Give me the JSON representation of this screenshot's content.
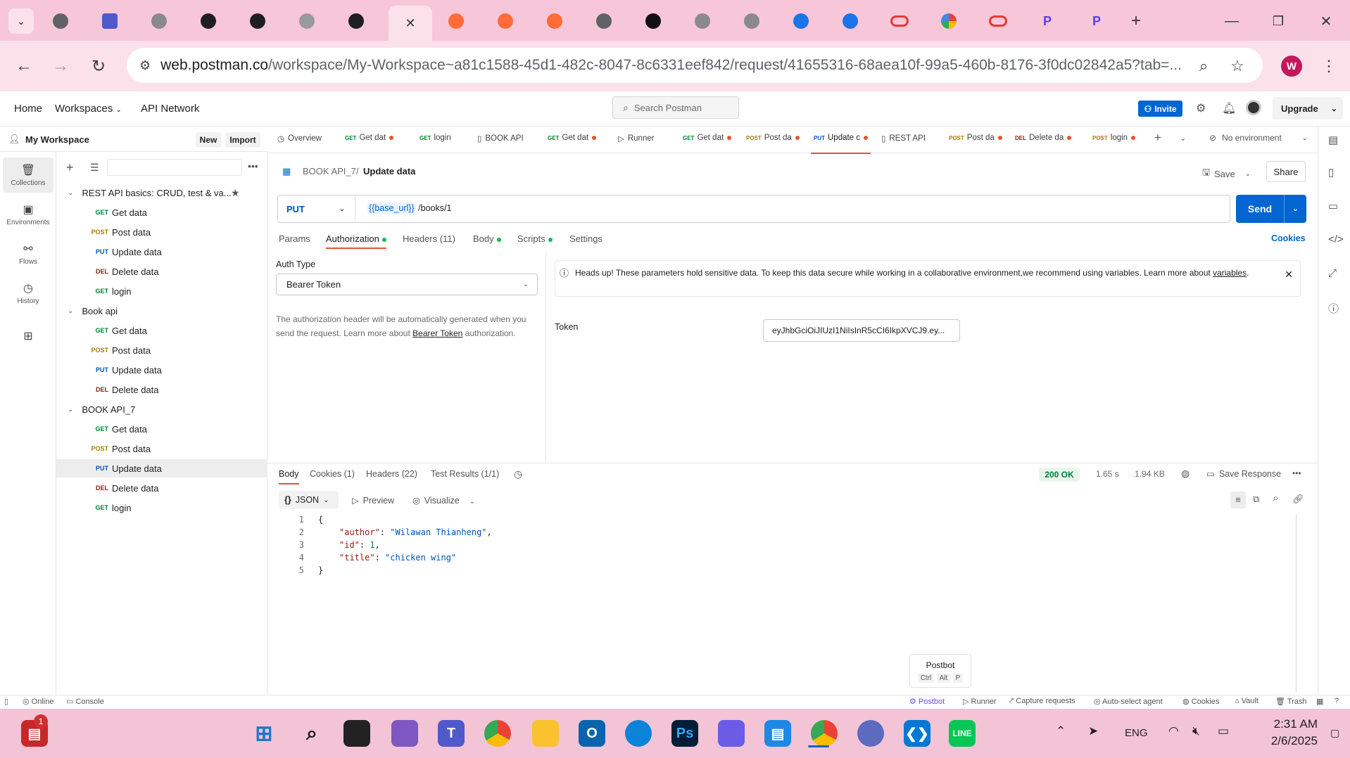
{
  "browser": {
    "url_host": "web.postman.co",
    "url_path": "/workspace/My-Workspace~a81c1588-45d1-482c-8047-8c6331eef842/request/41655316-68aea10f-99a5-460b-8176-3f0dc02842a5?tab=...",
    "profile_initial": "W"
  },
  "header": {
    "nav": [
      "Home",
      "Workspaces",
      "API Network"
    ],
    "search_placeholder": "Search Postman",
    "invite": "Invite",
    "upgrade": "Upgrade"
  },
  "rail": [
    "Collections",
    "Environments",
    "Flows",
    "History"
  ],
  "workspace": {
    "name": "My Workspace",
    "new": "New",
    "import": "Import"
  },
  "collections": [
    {
      "name": "REST API basics: CRUD, test & va...",
      "items": [
        {
          "method": "GET",
          "name": "Get data"
        },
        {
          "method": "POST",
          "name": "Post data"
        },
        {
          "method": "PUT",
          "name": "Update data"
        },
        {
          "method": "DEL",
          "name": "Delete data"
        },
        {
          "method": "GET",
          "name": "login"
        }
      ]
    },
    {
      "name": "Book api",
      "items": [
        {
          "method": "GET",
          "name": "Get data"
        },
        {
          "method": "POST",
          "name": "Post data"
        },
        {
          "method": "PUT",
          "name": "Update data"
        },
        {
          "method": "DEL",
          "name": "Delete data"
        }
      ]
    },
    {
      "name": "BOOK API_7",
      "items": [
        {
          "method": "GET",
          "name": "Get data"
        },
        {
          "method": "POST",
          "name": "Post data"
        },
        {
          "method": "PUT",
          "name": "Update data"
        },
        {
          "method": "DEL",
          "name": "Delete data"
        },
        {
          "method": "GET",
          "name": "login"
        }
      ]
    }
  ],
  "request_tabs": [
    {
      "method": "",
      "label": "Overview"
    },
    {
      "method": "GET",
      "label": "Get dat"
    },
    {
      "method": "GET",
      "label": "login"
    },
    {
      "method": "",
      "label": "BOOK API"
    },
    {
      "method": "GET",
      "label": "Get dat"
    },
    {
      "method": "",
      "label": "Runner"
    },
    {
      "method": "GET",
      "label": "Get dat"
    },
    {
      "method": "POST",
      "label": "Post da"
    },
    {
      "method": "PUT",
      "label": "Update c"
    },
    {
      "method": "",
      "label": "REST API"
    },
    {
      "method": "POST",
      "label": "Post da"
    },
    {
      "method": "DEL",
      "label": "Delete da"
    },
    {
      "method": "POST",
      "label": "login"
    }
  ],
  "environment": "No environment",
  "breadcrumb": {
    "collection": "BOOK API_7",
    "request": "Update data"
  },
  "actions": {
    "save": "Save",
    "share": "Share",
    "send": "Send",
    "cookies": "Cookies"
  },
  "request": {
    "method": "PUT",
    "url_var": "{{base_url}}",
    "url_path": "/books/1"
  },
  "subtabs": [
    "Params",
    "Authorization",
    "Headers (11)",
    "Body",
    "Scripts",
    "Settings"
  ],
  "auth": {
    "label": "Auth Type",
    "type": "Bearer Token",
    "desc": "The authorization header will be automatically generated when you send the request. Learn more about",
    "desc_link": "Bearer Token",
    "desc_end": "authorization.",
    "banner": "Heads up! These parameters hold sensitive data. To keep this data secure while working in a collaborative environment,we recommend using variables. Learn more about",
    "banner_link": "variables",
    "token_label": "Token",
    "token_value": "eyJhbGciOiJIUzI1NiIsInR5cCI6IkpXVCJ9.ey..."
  },
  "response": {
    "tabs": [
      "Body",
      "Cookies (1)",
      "Headers (22)",
      "Test Results (1/1)"
    ],
    "status": "200 OK",
    "time": "1.65 s",
    "size": "1.94 KB",
    "save": "Save Response",
    "format": "JSON",
    "preview": "Preview",
    "visualize": "Visualize",
    "json_author": "\"Wilawan Thianheng\"",
    "json_id": "1",
    "json_title": "\"chicken wing\""
  },
  "postbot": {
    "title": "Postbot",
    "keys": [
      "Ctrl",
      "Alt",
      "P"
    ]
  },
  "statusbar": {
    "left": [
      "Online",
      "Console"
    ],
    "right": [
      "Postbot",
      "Runner",
      "Capture requests",
      "Auto-select agent",
      "Cookies",
      "Vault",
      "Trash"
    ]
  },
  "taskbar": {
    "lang": "ENG",
    "time": "2:31 AM",
    "date": "2/6/2025",
    "badge": "1"
  }
}
